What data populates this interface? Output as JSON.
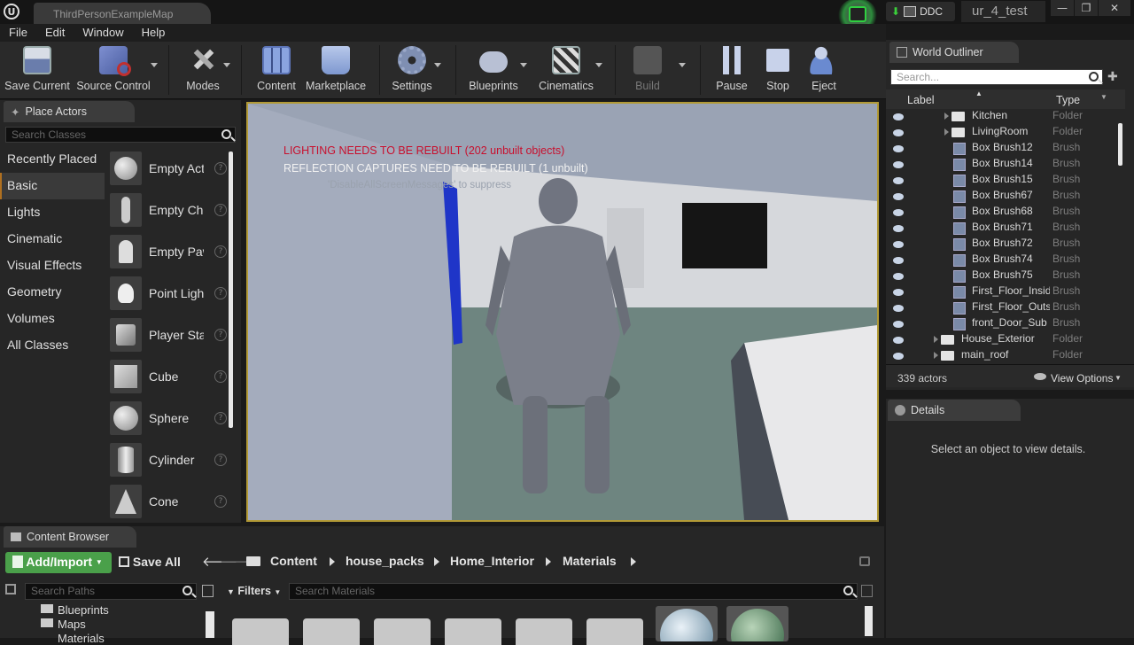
{
  "titlebar": {
    "logo": "U",
    "map_tab": "ThirdPersonExampleMap",
    "ddc_label": "DDC",
    "project_name": "ur_4_test",
    "window_buttons": [
      "—",
      "❐",
      "✕"
    ]
  },
  "menu": [
    "File",
    "Edit",
    "Window",
    "Help"
  ],
  "toolbar": {
    "save_current": "Save Current",
    "source_control": "Source Control",
    "modes": "Modes",
    "content": "Content",
    "marketplace": "Marketplace",
    "settings": "Settings",
    "blueprints": "Blueprints",
    "cinematics": "Cinematics",
    "build": "Build",
    "pause": "Pause",
    "stop": "Stop",
    "eject": "Eject"
  },
  "place_actors": {
    "tab_label": "Place Actors",
    "search_placeholder": "Search Classes",
    "categories": [
      "Recently Placed",
      "Basic",
      "Lights",
      "Cinematic",
      "Visual Effects",
      "Geometry",
      "Volumes",
      "All Classes"
    ],
    "selected_category": "Basic",
    "actors": [
      "Empty Actor",
      "Empty Character",
      "Empty Pawn",
      "Point Light",
      "Player Start",
      "Cube",
      "Sphere",
      "Cylinder",
      "Cone"
    ]
  },
  "viewport": {
    "warning_lighting": "LIGHTING NEEDS TO BE REBUILT (202 unbuilt objects)",
    "warning_reflection": "REFLECTION CAPTURES NEED TO BE REBUILT (1 unbuilt)",
    "suppress_hint": "'DisableAllScreenMessages' to suppress"
  },
  "world_outliner": {
    "tab_label": "World Outliner",
    "search_placeholder": "Search...",
    "col_label": "Label",
    "col_type": "Type",
    "rows": [
      {
        "label": "Kitchen",
        "type": "Folder"
      },
      {
        "label": "LivingRoom",
        "type": "Folder"
      },
      {
        "label": "Box Brush12",
        "type": "Brush"
      },
      {
        "label": "Box Brush14",
        "type": "Brush"
      },
      {
        "label": "Box Brush15",
        "type": "Brush"
      },
      {
        "label": "Box Brush67",
        "type": "Brush"
      },
      {
        "label": "Box Brush68",
        "type": "Brush"
      },
      {
        "label": "Box Brush71",
        "type": "Brush"
      },
      {
        "label": "Box Brush72",
        "type": "Brush"
      },
      {
        "label": "Box Brush74",
        "type": "Brush"
      },
      {
        "label": "Box Brush75",
        "type": "Brush"
      },
      {
        "label": "First_Floor_Inside",
        "type": "Brush"
      },
      {
        "label": "First_Floor_Outside",
        "type": "Brush"
      },
      {
        "label": "front_Door_Sub",
        "type": "Brush"
      },
      {
        "label": "House_Exterior",
        "type": "Folder"
      },
      {
        "label": "main_roof",
        "type": "Folder"
      }
    ],
    "actor_count": "339 actors",
    "view_options": "View Options"
  },
  "details": {
    "tab_label": "Details",
    "empty_message": "Select an object to view details."
  },
  "content_browser": {
    "tab_label": "Content Browser",
    "add_import": "Add/Import",
    "save_all": "Save All",
    "breadcrumb": [
      "Content",
      "house_packs",
      "Home_Interior",
      "Materials"
    ],
    "search_paths_placeholder": "Search Paths",
    "filters_label": "Filters",
    "search_materials_placeholder": "Search Materials",
    "tree": [
      "Blueprints",
      "Maps",
      "Materials"
    ]
  }
}
